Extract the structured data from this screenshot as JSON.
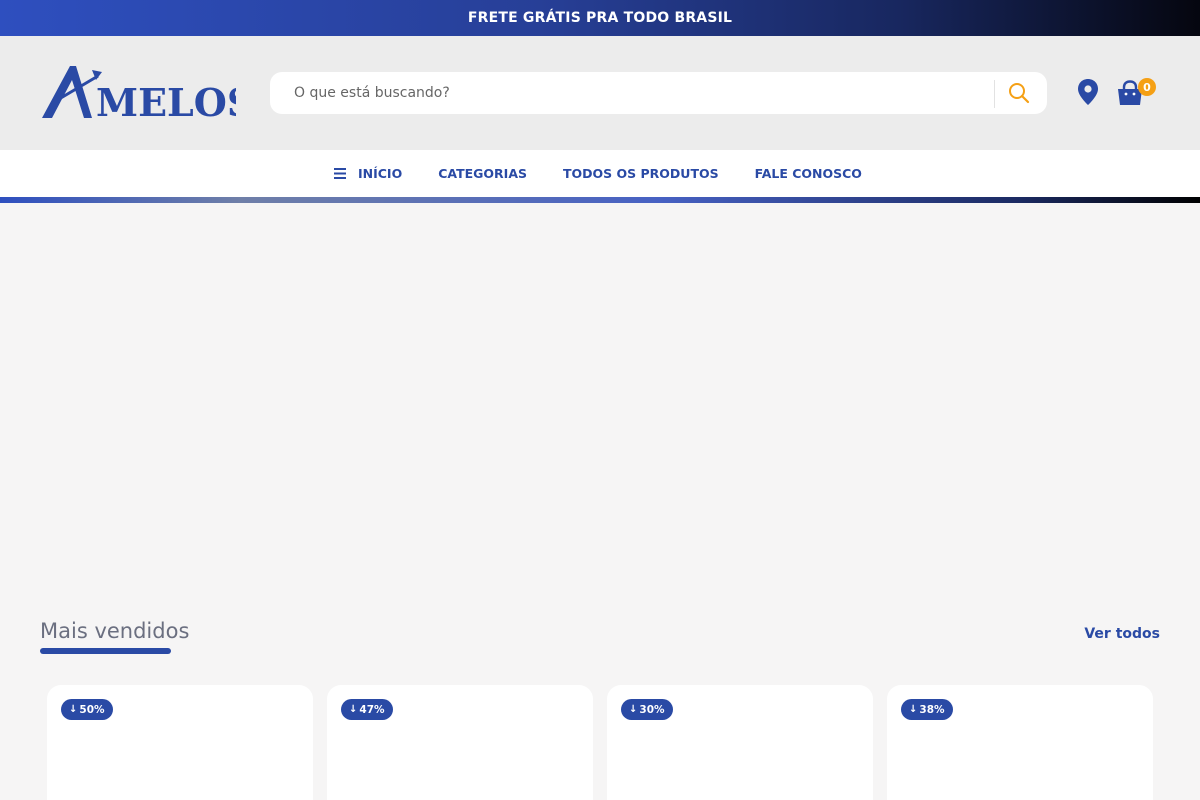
{
  "topbar": {
    "message": "FRETE GRÁTIS PRA TODO BRASIL"
  },
  "header": {
    "brand": "MELOS",
    "search_placeholder": "O que está buscando?",
    "cart_count": "0"
  },
  "nav": {
    "items": [
      {
        "label": "INÍCIO"
      },
      {
        "label": "CATEGORIAS"
      },
      {
        "label": "TODOS OS PRODUTOS"
      },
      {
        "label": "FALE CONOSCO"
      }
    ]
  },
  "bestsellers": {
    "title": "Mais vendidos",
    "see_all": "Ver todos",
    "products": [
      {
        "discount": "50%"
      },
      {
        "discount": "47%"
      },
      {
        "discount": "30%"
      },
      {
        "discount": "38%"
      }
    ]
  },
  "colors": {
    "brand_blue": "#2a4aa5",
    "accent_orange": "#f5a015",
    "page_bg": "#f6f5f5"
  }
}
